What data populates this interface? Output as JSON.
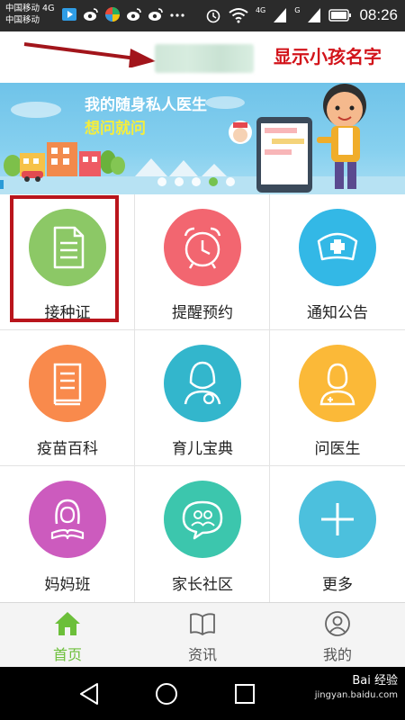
{
  "status_bar": {
    "carrier_1": "中国移动 4G",
    "carrier_2": "中国移动",
    "network_1": "4G",
    "network_2": "G",
    "time": "08:26",
    "notification_icons": [
      "media-icon",
      "weibo-icon",
      "app-icon",
      "weibo-icon",
      "weibo-icon",
      "more-icon"
    ]
  },
  "header": {
    "child_name_placeholder": "",
    "annotation": "显示小孩名字"
  },
  "banner": {
    "title": "我的随身私人医生",
    "subtitle": "想问就问",
    "slide_count": 5,
    "active_slide": 4
  },
  "menu": [
    {
      "label": "接种证",
      "icon": "document-icon",
      "color": "#8cc866"
    },
    {
      "label": "提醒预约",
      "icon": "alarm-clock-icon",
      "color": "#f26670"
    },
    {
      "label": "通知公告",
      "icon": "nurse-cap-icon",
      "color": "#33b8e6"
    },
    {
      "label": "疫苗百科",
      "icon": "book-icon",
      "color": "#f98a4c"
    },
    {
      "label": "育儿宝典",
      "icon": "mother-icon",
      "color": "#33b6cc"
    },
    {
      "label": "问医生",
      "icon": "doctor-icon",
      "color": "#fbb938"
    },
    {
      "label": "妈妈班",
      "icon": "woman-reading-icon",
      "color": "#cc5bbe"
    },
    {
      "label": "家长社区",
      "icon": "community-icon",
      "color": "#3cc6ad"
    },
    {
      "label": "更多",
      "icon": "plus-icon",
      "color": "#4cc0dd"
    }
  ],
  "bottom_nav": [
    {
      "label": "首页",
      "icon": "home-icon",
      "active": true
    },
    {
      "label": "资讯",
      "icon": "open-book-icon",
      "active": false
    },
    {
      "label": "我的",
      "icon": "user-icon",
      "active": false
    }
  ],
  "watermark": {
    "text": "Bai 经验",
    "url": "jingyan.baidu.com"
  },
  "colors": {
    "accent_green": "#6cbf3a",
    "annotation_red": "#d2131a"
  }
}
